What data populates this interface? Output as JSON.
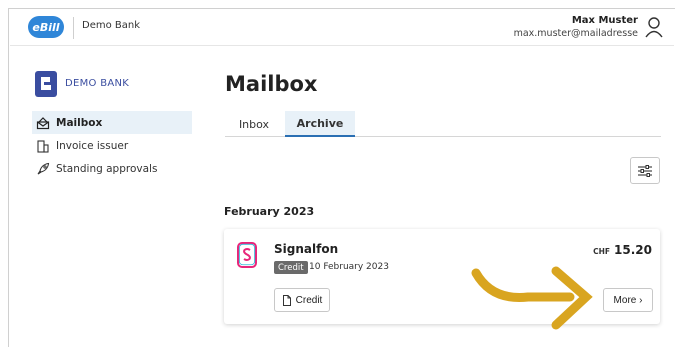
{
  "header": {
    "logo_text": "eBill",
    "bank_name": "Demo Bank",
    "user_name": "Max Muster",
    "user_email": "max.muster@mailadresse"
  },
  "sidebar": {
    "logo_text": "DEMO BANK",
    "items": [
      {
        "label": "Mailbox",
        "icon": "mailbox-icon",
        "active": true
      },
      {
        "label": "Invoice issuer",
        "icon": "building-icon",
        "active": false
      },
      {
        "label": "Standing approvals",
        "icon": "rocket-icon",
        "active": false
      }
    ]
  },
  "main": {
    "title": "Mailbox",
    "tabs": [
      {
        "label": "Inbox",
        "active": false
      },
      {
        "label": "Archive",
        "active": true
      }
    ],
    "month": "February 2023",
    "invoices": [
      {
        "issuer": "Signalfon",
        "badge": "Credit",
        "date": "10 February 2023",
        "currency": "CHF",
        "amount": "15.20",
        "credit_button": "Credit",
        "more_button": "More ›"
      }
    ]
  },
  "colors": {
    "accent": "#2a6fb3",
    "active_bg": "#e8f1f8",
    "annotation_arrow": "#d9a520",
    "issuer_pink": "#e8267a",
    "issuer_cyan": "#2bb7d6"
  }
}
